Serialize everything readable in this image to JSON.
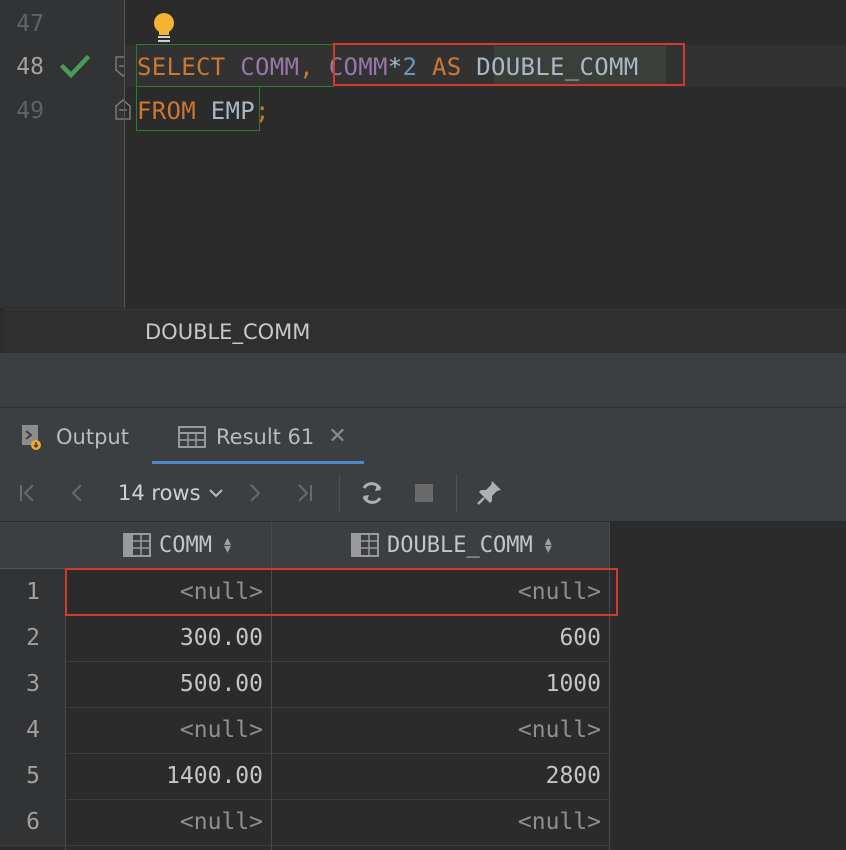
{
  "editor": {
    "lines": [
      {
        "number": "47"
      },
      {
        "number": "48"
      },
      {
        "number": "49"
      }
    ],
    "code": {
      "line48": {
        "select": "SELECT",
        "comm": "COMM",
        "comma": ",",
        "comm2": "COMM",
        "star": "*",
        "two": "2",
        "as": "AS",
        "alias": "DOUBLE_COMM"
      },
      "line49": {
        "from": "FROM",
        "emp": "EMP",
        "semi": ";"
      }
    },
    "breadcrumb": "DOUBLE_COMM"
  },
  "tabs": {
    "output_label": "Output",
    "result_label": "Result 61"
  },
  "toolbar": {
    "rows_label": "14 rows"
  },
  "grid": {
    "columns": [
      "COMM",
      "DOUBLE_COMM"
    ],
    "rows": [
      {
        "num": "1",
        "comm": "<null>",
        "double": "<null>"
      },
      {
        "num": "2",
        "comm": "300.00",
        "double": "600"
      },
      {
        "num": "3",
        "comm": "500.00",
        "double": "1000"
      },
      {
        "num": "4",
        "comm": "<null>",
        "double": "<null>"
      },
      {
        "num": "5",
        "comm": "1400.00",
        "double": "2800"
      },
      {
        "num": "6",
        "comm": "<null>",
        "double": "<null>"
      }
    ]
  },
  "colors": {
    "keyword": "#cc7832",
    "column": "#9876aa",
    "number": "#6897bb",
    "highlight_box": "#d13b2a",
    "selected_tab": "#4a88c7"
  }
}
